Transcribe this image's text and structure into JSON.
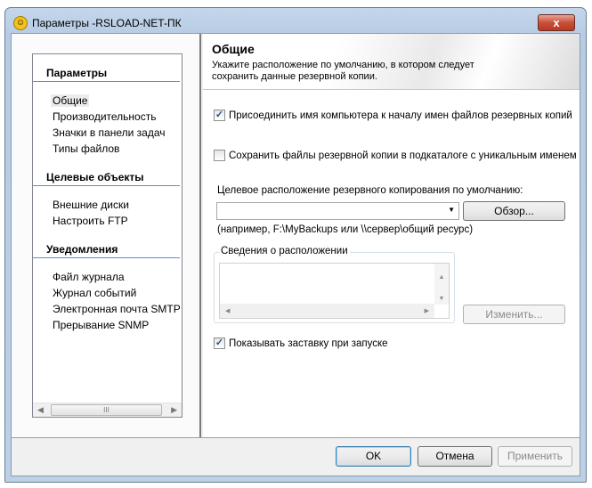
{
  "window": {
    "title": "Параметры -RSLOAD-NET-ПК",
    "close_label": "x"
  },
  "sidebar": {
    "sections": [
      {
        "title": "Параметры",
        "items": [
          "Общие",
          "Производительность",
          "Значки в панели задач",
          "Типы файлов"
        ]
      },
      {
        "title": "Целевые объекты",
        "items": [
          "Внешние диски",
          "Настроить FTP"
        ]
      },
      {
        "title": "Уведомления",
        "items": [
          "Файл журнала",
          "Журнал событий",
          "Электронная почта SMTP",
          "Прерывание SNMP"
        ]
      }
    ],
    "selected": "Общие"
  },
  "header": {
    "title": "Общие",
    "description": "Укажите расположение по умолчанию, в котором следует сохранить данные резервной копии."
  },
  "options": {
    "prepend_name": {
      "label": "Присоединить имя компьютера к началу имен файлов резервных копий",
      "checked": true
    },
    "subfolder": {
      "label": "Сохранить файлы резервной копии в подкаталоге с уникальным именем",
      "checked": false
    },
    "splash": {
      "label": "Показывать заставку при запуске",
      "checked": true
    }
  },
  "location": {
    "label": "Целевое расположение резервного копирования по умолчанию:",
    "value": "",
    "browse": "Обзор...",
    "hint": "(например, F:\\MyBackups или \\\\сервер\\общий ресурс)"
  },
  "details": {
    "group_label": "Сведения о расположении",
    "change": "Изменить..."
  },
  "buttons": {
    "ok": "OK",
    "cancel": "Отмена",
    "apply": "Применить"
  },
  "check_mark": "✓"
}
